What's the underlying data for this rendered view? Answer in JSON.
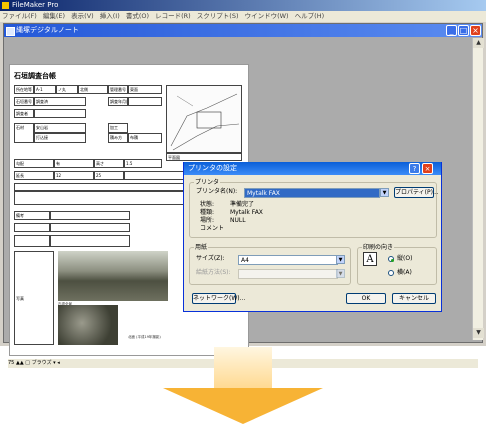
{
  "app": {
    "title": "FileMaker Pro",
    "menu": [
      "ファイル(F)",
      "編集(E)",
      "表示(V)",
      "挿入(I)",
      "書式(O)",
      "レコード(R)",
      "スクリプト(S)",
      "ウインドウ(W)",
      "ヘルプ(H)"
    ]
  },
  "document": {
    "title": "縄塚デジタルノート",
    "record_title": "石垣調査台帳",
    "status": {
      "zoom": "75",
      "mode": "ブラウズ"
    }
  },
  "record": {
    "labels": [
      "所在地等",
      "管理番号",
      "石垣番号",
      "調査年月日",
      "調査者",
      "石材",
      "加工",
      "積み方",
      "勾配",
      "高さ",
      "延長",
      "備考",
      "写真",
      "平面図"
    ],
    "values": [
      "A-1",
      "ノ丸",
      "北側",
      "東面",
      "調査済",
      "安山岩",
      "打込接",
      "布積",
      "有",
      "1.5",
      "12",
      "25"
    ]
  },
  "photo": {
    "caption_1": "石垣全景",
    "caption_2": "北面 (平成19年撮影)"
  },
  "dialog": {
    "title": "プリンタの設定",
    "printer_group": "プリンタ",
    "printer_name_label": "プリンタ名(N):",
    "printer_name_value": "Mytalk FAX",
    "properties_button": "プロパティ(P)...",
    "status_label": "状態:",
    "status_value": "準備完了",
    "type_label": "種類:",
    "type_value": "Mytalk FAX",
    "where_label": "場所:",
    "where_value": "NULL",
    "comment_label": "コメント",
    "paper_group": "用紙",
    "size_label": "サイズ(Z):",
    "size_value": "A4",
    "source_label": "給紙方法(S):",
    "source_value": "",
    "orientation_group": "印刷の向き",
    "portrait_label": "縦(O)",
    "landscape_label": "横(A)",
    "network_button": "ネットワーク(W)...",
    "ok_button": "OK",
    "cancel_button": "キャンセル"
  }
}
